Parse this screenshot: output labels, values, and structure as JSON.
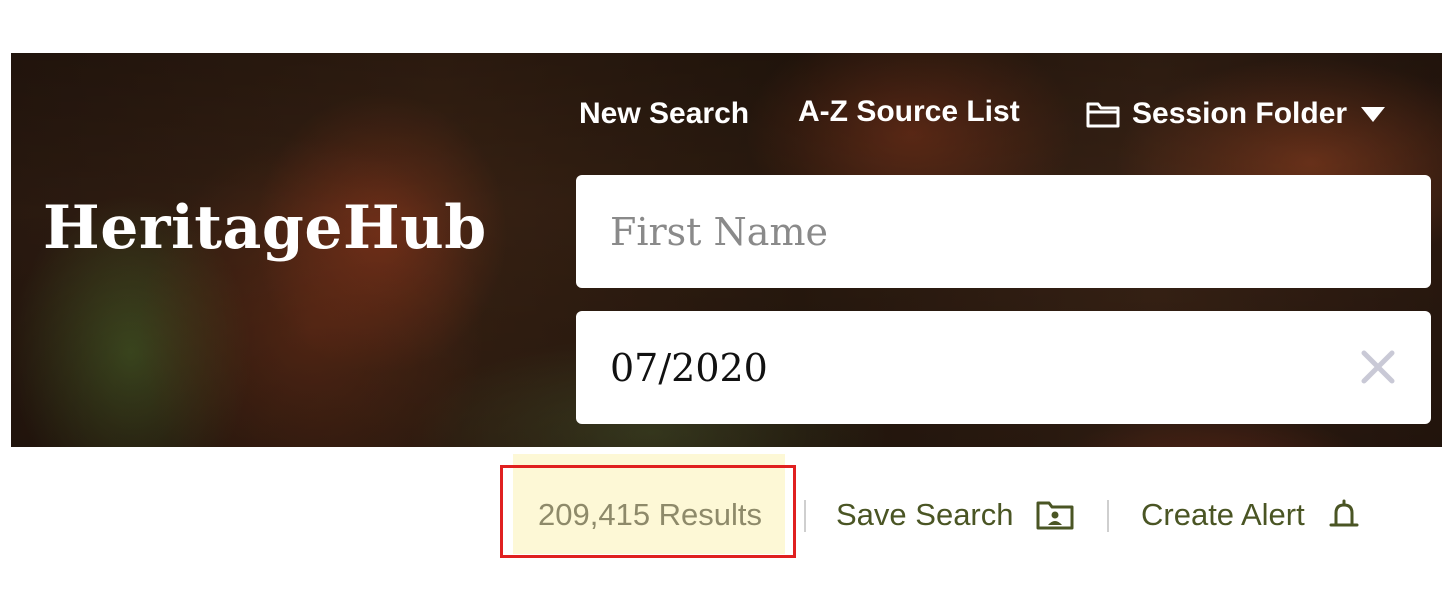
{
  "brand": {
    "name": "HeritageHub"
  },
  "nav": {
    "new_search": "New Search",
    "source_list": "A-Z Source List",
    "session_folder": "Session Folder"
  },
  "search": {
    "first_name_placeholder": "First Name",
    "date_value": "07/2020"
  },
  "results_bar": {
    "count_text": "209,415 Results",
    "save_search": "Save Search",
    "create_alert": "Create Alert"
  },
  "colors": {
    "brand_text": "#ffffff",
    "action_text": "#4a5524",
    "results_text": "#8e8a6a",
    "results_highlight": "#fdf8d6",
    "annotation_box": "#e02020"
  },
  "icons": {
    "session_folder": "folder-icon",
    "session_dropdown": "caret-down-icon",
    "clear_date": "close-icon",
    "save_search": "folder-user-icon",
    "create_alert": "bell-icon"
  }
}
